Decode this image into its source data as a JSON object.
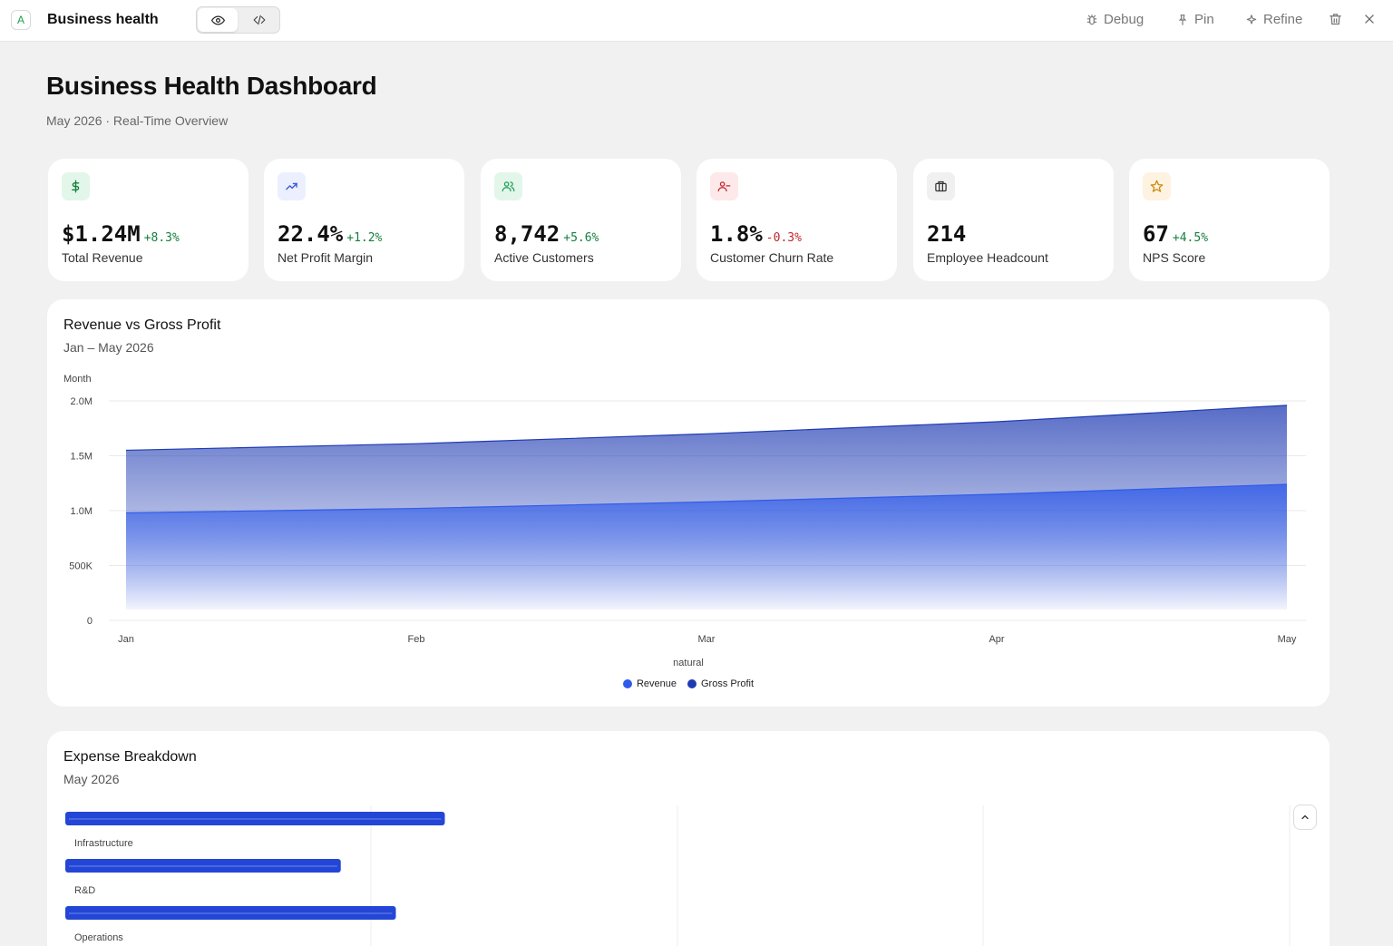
{
  "app": {
    "badge": "A",
    "title": "Business health",
    "actions": {
      "debug": "Debug",
      "pin": "Pin",
      "refine": "Refine"
    }
  },
  "header": {
    "title": "Business Health Dashboard",
    "subtitle": "May 2026 · Real-Time Overview"
  },
  "kpis": [
    {
      "value": "$1.24M",
      "delta": "+8.3%",
      "trend": "positive",
      "label": "Total Revenue",
      "icon": "dollar-icon",
      "icon_color": "#15803d",
      "icon_bg": "#e3f6ea"
    },
    {
      "value": "22.4%",
      "delta": "+1.2%",
      "trend": "positive",
      "label": "Net Profit Margin",
      "icon": "trending-up-icon",
      "icon_color": "#3b5bd9",
      "icon_bg": "#eceffd"
    },
    {
      "value": "8,742",
      "delta": "+5.6%",
      "trend": "positive",
      "label": "Active Customers",
      "icon": "users-icon",
      "icon_color": "#1e9e5a",
      "icon_bg": "#e3f6ea"
    },
    {
      "value": "1.8%",
      "delta": "-0.3%",
      "trend": "negative",
      "label": "Customer Churn Rate",
      "icon": "user-minus-icon",
      "icon_color": "#c0262d",
      "icon_bg": "#fde9e9"
    },
    {
      "value": "214",
      "delta": "",
      "trend": "neutral",
      "label": "Employee Headcount",
      "icon": "briefcase-icon",
      "icon_color": "#333333",
      "icon_bg": "#f0f0f0"
    },
    {
      "value": "67",
      "delta": "+4.5%",
      "trend": "positive",
      "label": "NPS Score",
      "icon": "star-icon",
      "icon_color": "#c98a0b",
      "icon_bg": "#fdf3e0"
    }
  ],
  "revenue_panel": {
    "title": "Revenue vs Gross Profit",
    "subtitle": "Jan – May 2026"
  },
  "expense_panel": {
    "title": "Expense Breakdown",
    "subtitle": "May 2026"
  },
  "colors": {
    "revenue": "#2f5bea",
    "gross_profit": "#1f3bb3",
    "expense_bar": "#2446d6",
    "positive": "#15803d",
    "negative": "#c0262d"
  },
  "chart_data": [
    {
      "type": "area",
      "title": "Revenue vs Gross Profit",
      "subtitle": "Jan – May 2026",
      "ylabel": "Month",
      "xlabel": "natural",
      "categories": [
        "Jan",
        "Feb",
        "Mar",
        "Apr",
        "May"
      ],
      "y_ticks": [
        "0",
        "500K",
        "1.0M",
        "1.5M",
        "2.0M"
      ],
      "ylim": [
        0,
        2000000
      ],
      "grid": true,
      "legend_position": "bottom",
      "series": [
        {
          "name": "Revenue",
          "values": [
            980000,
            1020000,
            1080000,
            1150000,
            1240000
          ]
        },
        {
          "name": "Gross Profit",
          "values": [
            1550000,
            1610000,
            1700000,
            1810000,
            1960000
          ]
        }
      ]
    },
    {
      "type": "bar",
      "orientation": "horizontal",
      "title": "Expense Breakdown",
      "subtitle": "May 2026",
      "categories": [
        "Infrastructure",
        "R&D",
        "Operations"
      ],
      "values": [
        0.62,
        0.45,
        0.54
      ],
      "grid": true
    }
  ]
}
